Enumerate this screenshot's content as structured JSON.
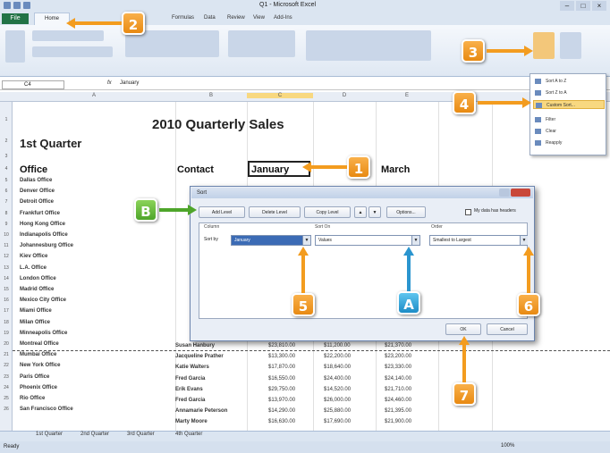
{
  "window": {
    "title": "Q1 - Microsoft Excel"
  },
  "tabs": {
    "file": "File",
    "home": "Home",
    "formulas": "Formulas",
    "data": "Data",
    "review": "Review",
    "view": "View",
    "addins": "Add-Ins"
  },
  "formula_bar": {
    "name_box": "C4",
    "fx": "fx",
    "value": "January"
  },
  "columns": [
    "A",
    "B",
    "C",
    "D",
    "E",
    "F"
  ],
  "sheet": {
    "title": "2010 Quarterly Sales",
    "subtitle": "1st Quarter",
    "headers": {
      "office": "Office",
      "contact": "Contact",
      "january": "January",
      "march": "March"
    },
    "offices": [
      "Dallas Office",
      "Denver Office",
      "Detroit Office",
      "Frankfurt Office",
      "Hong Kong Office",
      "Indianapolis Office",
      "Johannesburg Office",
      "Kiev Office",
      "L.A. Office",
      "London Office",
      "Madrid Office",
      "Mexico City Office",
      "Miami Office",
      "Milan Office",
      "Minneapolis Office",
      "Montreal Office",
      "Mumbai Office",
      "New York Office",
      "Paris Office",
      "Phoenix Office",
      "Rio Office",
      "San Francisco Office"
    ],
    "contacts_visible": [
      "Susan Hanbury",
      "Jacqueline Prather",
      "Katie Walters",
      "Fred Garcia",
      "Erik Evans",
      "Fred Garcia",
      "Annamarie Peterson",
      "Marty Moore"
    ],
    "values_visible": [
      [
        "$23,810.00",
        "$11,200.00",
        "$21,370.00"
      ],
      [
        "$13,300.00",
        "$22,200.00",
        "$23,200.00"
      ],
      [
        "$17,870.00",
        "$18,640.00",
        "$23,330.00"
      ],
      [
        "$16,550.00",
        "$24,400.00",
        "$24,140.00"
      ],
      [
        "$29,750.00",
        "$14,520.00",
        "$21,710.00"
      ],
      [
        "$13,970.00",
        "$26,000.00",
        "$24,460.00"
      ],
      [
        "$14,290.00",
        "$25,880.00",
        "$21,395.00"
      ],
      [
        "$16,630.00",
        "$17,690.00",
        "$21,900.00"
      ]
    ]
  },
  "menu": {
    "items": [
      "Sort A to Z",
      "Sort Z to A",
      "Custom Sort...",
      "Filter",
      "Clear",
      "Reapply"
    ]
  },
  "dialog": {
    "title": "Sort",
    "add_level": "Add Level",
    "delete_level": "Delete Level",
    "copy_level": "Copy Level",
    "options": "Options...",
    "header_checkbox": "My data has headers",
    "col_header": "Column",
    "sorton_header": "Sort On",
    "order_header": "Order",
    "sort_by": "Sort by",
    "column_value": "January",
    "sorton_value": "Values",
    "order_value": "Smallest to Largest",
    "ok": "OK",
    "cancel": "Cancel"
  },
  "sheet_tabs": [
    "1st Quarter",
    "2nd Quarter",
    "3rd Quarter",
    "4th Quarter"
  ],
  "status": {
    "ready": "Ready",
    "zoom": "100%"
  },
  "callouts": {
    "c1": "1",
    "c2": "2",
    "c3": "3",
    "c4": "4",
    "c5": "5",
    "c6": "6",
    "c7": "7",
    "cA": "A",
    "cB": "B"
  }
}
